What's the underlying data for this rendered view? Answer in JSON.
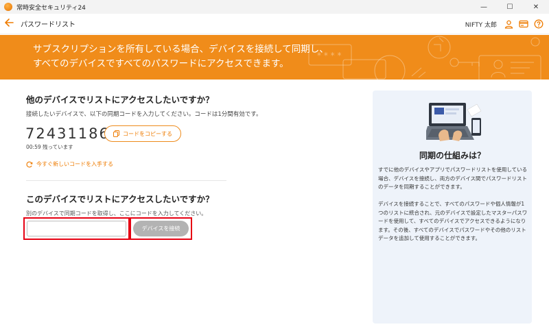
{
  "window": {
    "app_title": "常時安全セキュリティ24",
    "minimize": "—",
    "maximize": "☐",
    "close": "✕"
  },
  "header": {
    "title": "パスワードリスト",
    "user_name": "NIFTY 太郎"
  },
  "banner": {
    "text": "サブスクリプションを所有している場合、デバイスを接続して同期し、すべてのデバイスですべてのパスワードにアクセスできます。"
  },
  "other_device": {
    "title": "他のデバイスでリストにアクセスしたいですか？",
    "description": "接続したいデバイスで、以下の同期コードを入力してください。コードは1分間有効です。",
    "sync_code": "72431186",
    "timer": "00:59 残っています",
    "copy_button": "コードをコピーする",
    "new_code_link": "今すぐ新しいコードを入手する"
  },
  "this_device": {
    "title": "このデバイスでリストにアクセスしたいですか？",
    "description": "別のデバイスで同期コードを取得し、ここにコードを入力してください。",
    "input_value": "",
    "input_placeholder": "",
    "connect_button": "デバイスを接続"
  },
  "info_card": {
    "title": "同期の仕組みは？",
    "paragraph1": "すでに他のデバイスやアプリでパスワードリストを使用している場合、デバイスを接続し、両方のデバイス間でパスワードリストのデータを同期することができます。",
    "paragraph2": "デバイスを接続することで、すべてのパスワードや個人情報が1つのリストに統合され、元のデバイスで設定したマスターパスワードを使用して、すべてのデバイスでアクセスできるようになります。その後、すべてのデバイスでパスワードやその他のリストデータを追加して使用することができます。"
  },
  "colors": {
    "accent": "#ee7b00",
    "banner": "#f08c1a",
    "highlight_frame": "#e60012",
    "card_bg": "#eef3fa",
    "disabled_button": "#b3b3b3"
  },
  "icons": [
    "app-logo-icon",
    "back-arrow-icon",
    "user-icon",
    "card-icon",
    "help-icon",
    "copy-icon",
    "refresh-icon"
  ]
}
